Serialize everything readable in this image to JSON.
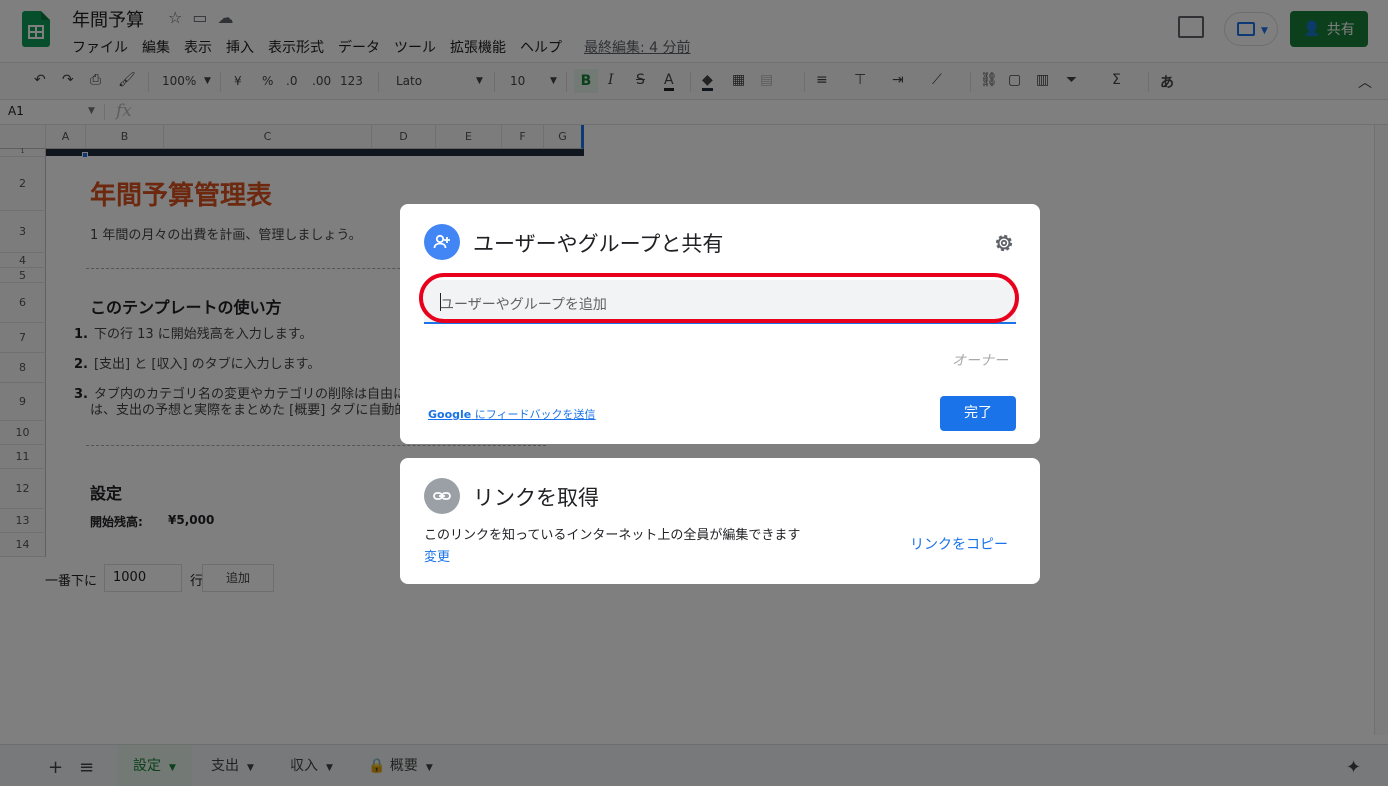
{
  "app": {
    "doc_title": "年間予算",
    "menu": [
      "ファイル",
      "編集",
      "表示",
      "挿入",
      "表示形式",
      "データ",
      "ツール",
      "拡張機能",
      "ヘルプ"
    ],
    "last_edit": "最終編集: 4 分前",
    "share_label": "共有"
  },
  "toolbar": {
    "zoom": "100%",
    "currency": "¥",
    "percent": "%",
    "dec_decrease": ".0",
    "dec_increase": ".00",
    "format_more": "123",
    "font": "Lato",
    "font_size": "10",
    "bold": "B",
    "italic": "I",
    "strike": "S",
    "text_color": "A",
    "input_tool": "あ"
  },
  "formula_bar": {
    "cell_ref": "A1",
    "fx": "fx"
  },
  "grid": {
    "columns": [
      "A",
      "B",
      "C",
      "D",
      "E",
      "F",
      "G"
    ],
    "rows": [
      "1",
      "2",
      "3",
      "4",
      "5",
      "6",
      "7",
      "8",
      "9",
      "10",
      "11",
      "12",
      "13",
      "14"
    ],
    "title": "年間予算管理表",
    "subtitle": "1 年間の月々の出費を計画、管理しましょう。",
    "howto_heading": "このテンプレートの使い方",
    "steps": [
      {
        "num": "1.",
        "text": "下の行 13 に開始残高を入力します。"
      },
      {
        "num": "2.",
        "text": "[支出] と [収入] のタブに入力します。"
      },
      {
        "num": "3.",
        "text": "タブ内のカテゴリ名の変更やカテゴリの削除は自由にできます。変更内容",
        "text2": "は、支出の予想と実際をまとめた [概要] タブに自動的に反映されます。"
      }
    ],
    "settings_heading": "設定",
    "start_balance_label": "開始残高:",
    "start_balance_value": "¥5,000",
    "add_rows_prefix": "一番下に",
    "add_rows_value": "1000",
    "add_rows_unit": "行",
    "add_rows_button": "追加"
  },
  "tabs": [
    {
      "label": "設定",
      "active": true
    },
    {
      "label": "支出",
      "active": false
    },
    {
      "label": "収入",
      "active": false
    },
    {
      "label": "概要",
      "active": false,
      "locked": true
    }
  ],
  "share_dialog": {
    "title": "ユーザーやグループと共有",
    "input_placeholder": "ユーザーやグループを追加",
    "owner_label": "オーナー",
    "feedback_brand": "Google",
    "feedback_text": " にフィードバックを送信",
    "done_label": "完了"
  },
  "link_dialog": {
    "title": "リンクを取得",
    "description": "このリンクを知っているインターネット上の全員が編集できます",
    "change_label": "変更",
    "copy_label": "リンクをコピー"
  },
  "colors": {
    "accent": "#1a73e8",
    "brand": "#188038",
    "highlight": "#e8001c",
    "title": "#d9531e"
  }
}
